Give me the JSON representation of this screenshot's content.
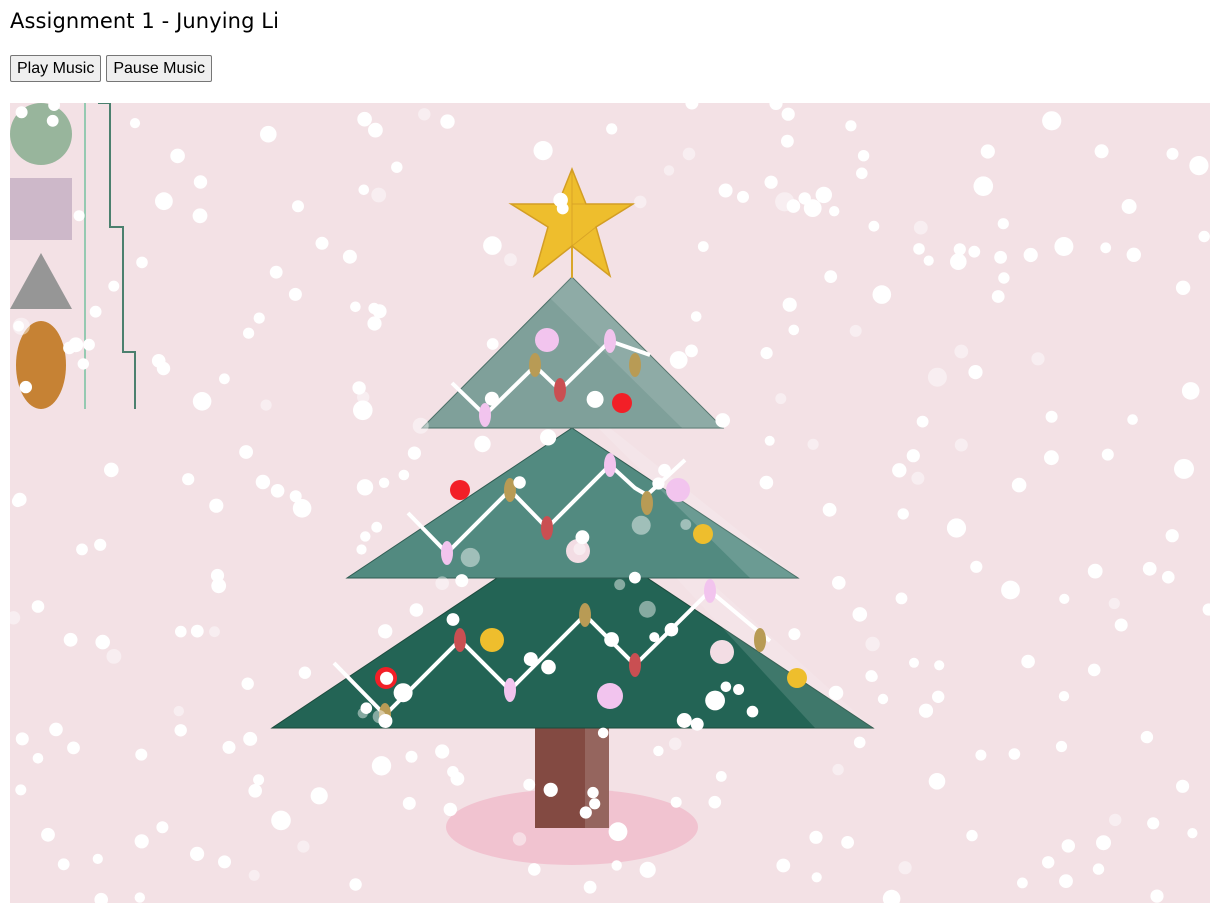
{
  "page": {
    "title": "Assignment 1 - Junying Li"
  },
  "controls": {
    "play_label": "Play Music",
    "pause_label": "Pause Music"
  },
  "canvas": {
    "background_color": "#f3e1e5",
    "legend_shapes": [
      {
        "shape": "circle",
        "color": "#98b59c"
      },
      {
        "shape": "square",
        "color": "#cdb8c9"
      },
      {
        "shape": "triangle",
        "color": "#969696"
      },
      {
        "shape": "ellipse",
        "color": "#c68234"
      }
    ],
    "tree": {
      "tier_colors": [
        "#7fa09a",
        "#528a80",
        "#236455"
      ],
      "trunk_color": "#834a42",
      "star_color": "#eebe2d",
      "shadow_color": "#f1c3d0",
      "ornament_colors": [
        "#f21f27",
        "#eebe2d",
        "#f2c4ee",
        "#f3dde4"
      ],
      "light_colors": [
        "#f2c4ee",
        "#b89b55",
        "#c94f52"
      ],
      "garland_color": "#ffffff"
    },
    "snow_color": "#ffffff"
  }
}
